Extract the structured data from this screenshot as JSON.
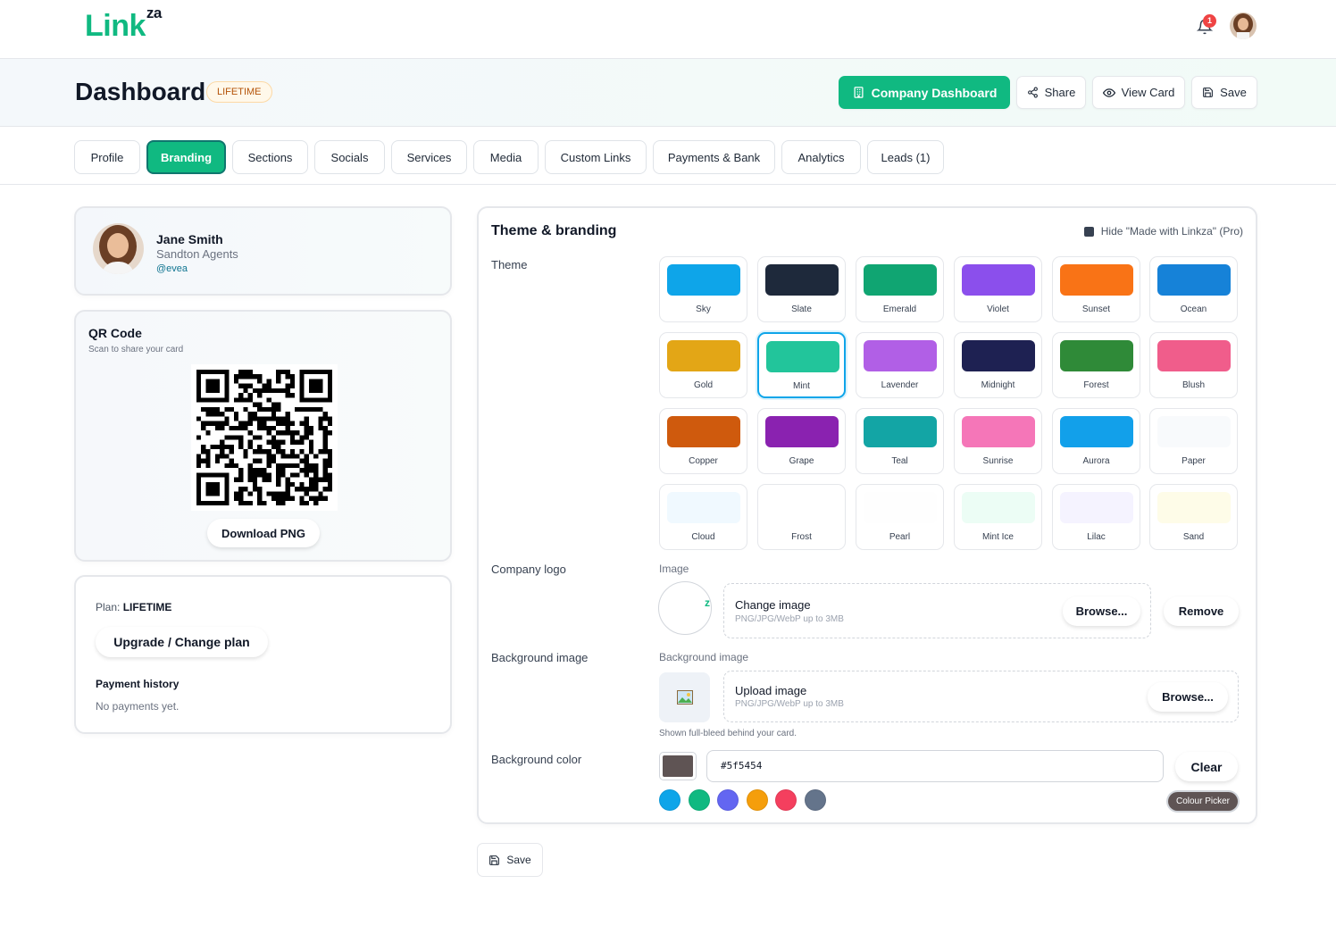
{
  "brand": {
    "logo_text": "Link",
    "logo_sup": "za"
  },
  "notifications": {
    "count": "1"
  },
  "header": {
    "title": "Dashboard",
    "plan_badge": "LIFETIME",
    "company_dashboard_label": "Company Dashboard",
    "share_label": "Share",
    "view_card_label": "View Card",
    "save_label": "Save"
  },
  "tabs": [
    {
      "label": "Profile"
    },
    {
      "label": "Branding",
      "active": true
    },
    {
      "label": "Sections"
    },
    {
      "label": "Socials"
    },
    {
      "label": "Services"
    },
    {
      "label": "Media"
    },
    {
      "label": "Custom Links"
    },
    {
      "label": "Payments & Bank"
    },
    {
      "label": "Analytics"
    },
    {
      "label": "Leads (1)"
    }
  ],
  "profile": {
    "name": "Jane Smith",
    "company": "Sandton Agents",
    "handle": "@evea"
  },
  "qr": {
    "title": "QR Code",
    "subtitle": "Scan to share your card",
    "download_label": "Download PNG"
  },
  "plan": {
    "label": "Plan:",
    "value": "LIFETIME",
    "upgrade_label": "Upgrade / Change plan",
    "payment_history_title": "Payment history",
    "payment_history_empty": "No payments yet."
  },
  "theme": {
    "title": "Theme & branding",
    "hide_made_with_label": "Hide \"Made with Linkza\" (Pro)",
    "theme_label": "Theme",
    "selected": "Mint",
    "swatches": [
      {
        "name": "Sky",
        "color": "#0ea5e9"
      },
      {
        "name": "Slate",
        "color": "#1e293b"
      },
      {
        "name": "Emerald",
        "color": "#10a572"
      },
      {
        "name": "Violet",
        "color": "#8b4fec"
      },
      {
        "name": "Sunset",
        "color": "#f97316"
      },
      {
        "name": "Ocean",
        "color": "#1682d8"
      },
      {
        "name": "Gold",
        "color": "#e3a616"
      },
      {
        "name": "Mint",
        "color": "#22c59b"
      },
      {
        "name": "Lavender",
        "color": "#b15fe6"
      },
      {
        "name": "Midnight",
        "color": "#1e2152"
      },
      {
        "name": "Forest",
        "color": "#2f8a38"
      },
      {
        "name": "Blush",
        "color": "#f05d8b"
      },
      {
        "name": "Copper",
        "color": "#cf5a0d"
      },
      {
        "name": "Grape",
        "color": "#8a22b0"
      },
      {
        "name": "Teal",
        "color": "#13a5a5"
      },
      {
        "name": "Sunrise",
        "color": "#f576b8"
      },
      {
        "name": "Aurora",
        "color": "#12a0ea"
      },
      {
        "name": "Paper",
        "color": "#f8fafc"
      },
      {
        "name": "Cloud",
        "color": "#f0f9ff"
      },
      {
        "name": "Frost",
        "color": "#ffffff"
      },
      {
        "name": "Pearl",
        "color": "#fefefe"
      },
      {
        "name": "Mint Ice",
        "color": "#ecfdf5"
      },
      {
        "name": "Lilac",
        "color": "#f5f3ff"
      },
      {
        "name": "Sand",
        "color": "#fefce8"
      }
    ]
  },
  "company_logo": {
    "label": "Company logo",
    "image_label": "Image",
    "logo_glyph": "z",
    "change_title": "Change image",
    "hint": "PNG/JPG/WebP up to 3MB",
    "browse_label": "Browse...",
    "remove_label": "Remove"
  },
  "background_image": {
    "label": "Background image",
    "sub_label": "Background image",
    "upload_title": "Upload image",
    "hint": "PNG/JPG/WebP up to 3MB",
    "browse_label": "Browse...",
    "note": "Shown full-bleed behind your card."
  },
  "background_color": {
    "label": "Background color",
    "value": "#5f5454",
    "clear_label": "Clear",
    "tooltip": "Colour Picker",
    "presets": [
      "#0ea5e9",
      "#10b981",
      "#6366f1",
      "#f59e0b",
      "#f43f5e",
      "#64748b"
    ]
  },
  "footer": {
    "save_label": "Save"
  }
}
